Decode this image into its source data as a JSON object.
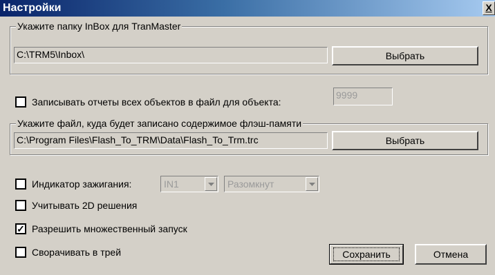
{
  "window": {
    "title": "Настройки",
    "close_label": "X"
  },
  "inbox_group": {
    "legend": "Укажите папку InBox для TranMaster",
    "path": "C:\\TRM5\\Inbox\\",
    "browse_label": "Выбрать"
  },
  "write_reports": {
    "label": "Записывать отчеты всех объектов в файл для объекта:",
    "object_value": "9999",
    "checked": false
  },
  "flash_group": {
    "legend": "Укажите файл, куда будет записано содержимое флэш-памяти",
    "path": "C:\\Program Files\\Flash_To_TRM\\Data\\Flash_To_Trm.trc",
    "browse_label": "Выбрать"
  },
  "ignition": {
    "label": "Индикатор зажигания:",
    "input_value": "IN1",
    "state_value": "Разомкнут",
    "checked": false
  },
  "use_2d": {
    "label": "Учитывать 2D решения",
    "checked": false
  },
  "multi_launch": {
    "label": "Разрешить множественный запуск",
    "checked": true,
    "mark": "✓"
  },
  "minimize_tray": {
    "label": "Сворачивать в трей",
    "checked": false
  },
  "buttons": {
    "save_label": "Сохранить",
    "cancel_label": "Отмена"
  }
}
